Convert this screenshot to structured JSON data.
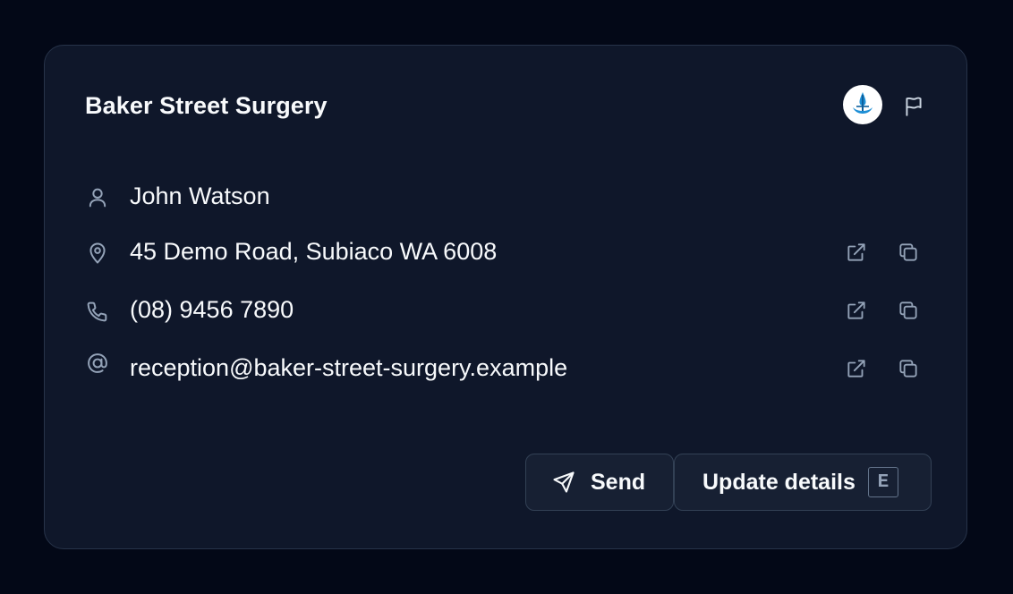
{
  "card": {
    "title": "Baker Street Surgery",
    "logo_icon": "practice-logo-icon",
    "flag_icon": "flag-icon"
  },
  "contact": {
    "name": "John Watson",
    "address": "45 Demo Road, Subiaco WA 6008",
    "phone": "(08) 9456 7890",
    "email": "reception@baker-street-surgery.example"
  },
  "icons": {
    "person": "person-icon",
    "location": "map-pin-icon",
    "phone": "phone-icon",
    "email": "at-sign-icon",
    "open": "external-link-icon",
    "copy": "copy-icon",
    "send": "send-icon"
  },
  "actions": {
    "send_label": "Send",
    "update_label": "Update details",
    "update_shortcut": "E"
  },
  "colors": {
    "page_background": "#030817",
    "card_background": "#0f172a",
    "card_border": "#273349",
    "text": "#f8fafc",
    "icon_muted": "#94a3b8",
    "logo_blue": "#1d8fd6"
  }
}
